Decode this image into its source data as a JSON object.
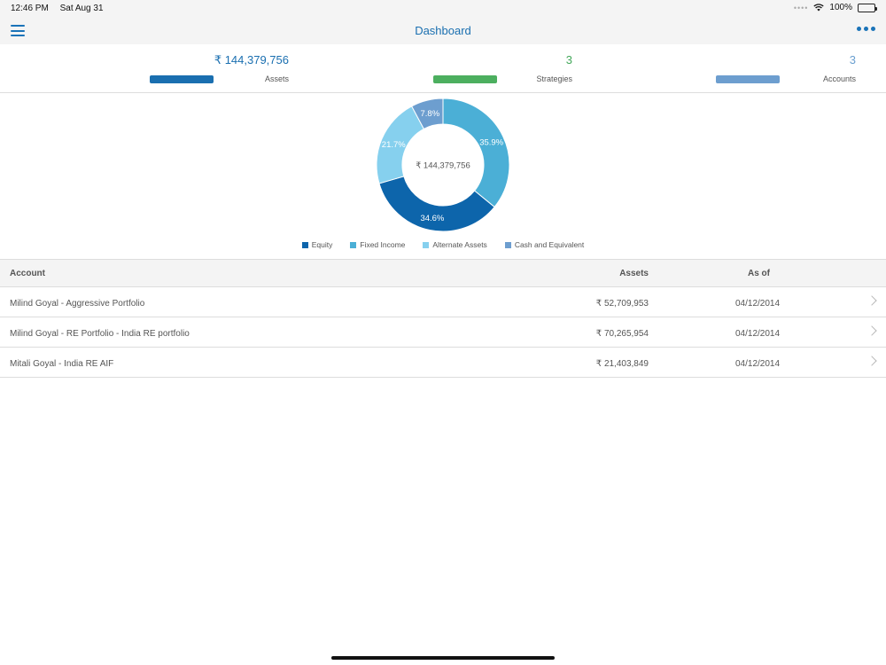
{
  "status_bar": {
    "time": "12:46 PM",
    "date": "Sat Aug 31",
    "battery": "100%",
    "signal_icon": "wifi-icon"
  },
  "nav": {
    "title": "Dashboard",
    "menu_icon": "hamburger-icon",
    "more_icon": "more-dots-icon"
  },
  "summary": {
    "assets": {
      "value": "₹ 144,379,756",
      "label": "Assets",
      "color": "#1a6fb0"
    },
    "strategies": {
      "value": "3",
      "label": "Strategies",
      "color": "#43a85a"
    },
    "accounts": {
      "value": "3",
      "label": "Accounts",
      "color": "#6a9fd0"
    }
  },
  "chart_data": {
    "type": "pie",
    "donut": true,
    "center_label": "₹ 144,379,756",
    "slices": [
      {
        "name": "Fixed Income",
        "value": 35.9,
        "label": "35.9%",
        "color": "#4bafd6"
      },
      {
        "name": "Equity",
        "value": 34.6,
        "label": "34.6%",
        "color": "#0d65ab"
      },
      {
        "name": "Alternate Assets",
        "value": 21.7,
        "label": "21.7%",
        "color": "#86d0ee"
      },
      {
        "name": "Cash and Equivalent",
        "value": 7.8,
        "label": "7.8%",
        "color": "#6d9ecf"
      }
    ],
    "legend": [
      "Equity",
      "Fixed Income",
      "Alternate Assets",
      "Cash and Equivalent"
    ],
    "legend_placement": "bottom"
  },
  "table": {
    "headers": {
      "account": "Account",
      "assets": "Assets",
      "as_of": "As of"
    },
    "rows": [
      {
        "account": "Milind Goyal - Aggressive Portfolio",
        "assets": "₹ 52,709,953",
        "as_of": "04/12/2014"
      },
      {
        "account": "Milind Goyal - RE Portfolio - India RE portfolio",
        "assets": "₹ 70,265,954",
        "as_of": "04/12/2014"
      },
      {
        "account": "Mitali Goyal - India RE AIF",
        "assets": "₹ 21,403,849",
        "as_of": "04/12/2014"
      }
    ]
  }
}
